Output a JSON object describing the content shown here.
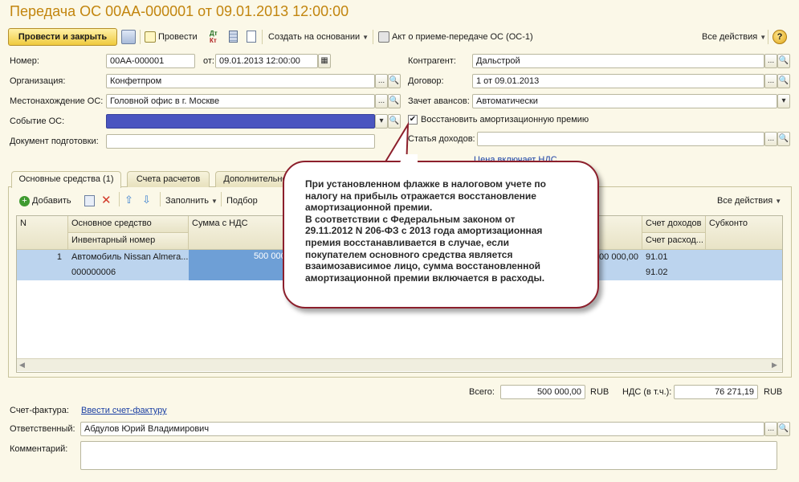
{
  "window": {
    "title": "Передача ОС 00АА-000001 от 09.01.2013 12:00:00"
  },
  "toolbar": {
    "post_close": "Провести и закрыть",
    "post": "Провести",
    "create_based": "Создать на основании",
    "act": "Акт о приеме-передаче ОС (ОС-1)",
    "all_actions": "Все действия",
    "help": "?"
  },
  "form": {
    "number_label": "Номер:",
    "number_value": "00АА-000001",
    "date_label": "от:",
    "date_value": "09.01.2013 12:00:00",
    "org_label": "Организация:",
    "org_value": "Конфетпром",
    "location_label": "Местонахождение ОС:",
    "location_value": "Головной офис в г. Москве",
    "event_label": "Событие ОС:",
    "event_value": "",
    "prep_doc_label": "Документ подготовки:",
    "prep_doc_value": "",
    "counterparty_label": "Контрагент:",
    "counterparty_value": "Дальстрой",
    "contract_label": "Договор:",
    "contract_value": "1 от 09.01.2013",
    "advance_label": "Зачет авансов:",
    "advance_value": "Автоматически",
    "restore_bonus_label": "Восстановить амортизационную премию",
    "restore_bonus_checked": "✔",
    "income_item_label": "Статья доходов:",
    "income_item_value": "",
    "vat_included_link": "Цена включает НДС"
  },
  "tabs": [
    {
      "label": "Основные средства (1)"
    },
    {
      "label": "Счета расчетов"
    },
    {
      "label": "Дополнительно"
    }
  ],
  "table_toolbar": {
    "add": "Добавить",
    "fill": "Заполнить",
    "select": "Подбор",
    "all_actions": "Все действия"
  },
  "table": {
    "headers": {
      "n": "N",
      "asset": "Основное средство",
      "inventory": "Инвентарный номер",
      "sum_vat": "Сумма с НДС",
      "income_account": "Счет доходов",
      "expense_account": "Счет расход...",
      "subconto": "Субконто"
    },
    "rows": [
      {
        "n": "1",
        "asset": "Автомобиль Nissan Almera...",
        "inventory": "000000006",
        "sum_vat": "500 000,00",
        "total": "500 000,00",
        "income_account": "91.01",
        "expense_account": "91.02"
      }
    ]
  },
  "callout": {
    "lines": [
      "При установленном флажке в налоговом учете по",
      "налогу на прибыль отражается восстановление",
      "амортизационной премии.",
      "В соответствии с Федеральным законом от",
      "29.11.2012 N 206-ФЗ  с 2013 года амортизационная",
      "премия восстанавливается в случае, если",
      "покупателем основного средства является",
      "взаимозависимое лицо, сумма восстановленной",
      "амортизационной премии включается в расходы."
    ]
  },
  "totals": {
    "total_label": "Всего:",
    "total_value": "500 000,00",
    "currency": "RUB",
    "vat_label": "НДС (в т.ч.):",
    "vat_value": "76 271,19",
    "vat_currency": "RUB"
  },
  "footer": {
    "invoice_label": "Счет-фактура:",
    "invoice_link": "Ввести счет-фактуру",
    "responsible_label": "Ответственный:",
    "responsible_value": "Абдулов Юрий Владимирович",
    "comment_label": "Комментарий:",
    "comment_value": ""
  },
  "colors": {
    "title": "#c2850e",
    "selected_row": "#bcd4ee",
    "callout_border": "#8c1f2c",
    "event_field": "#4a55c0"
  }
}
